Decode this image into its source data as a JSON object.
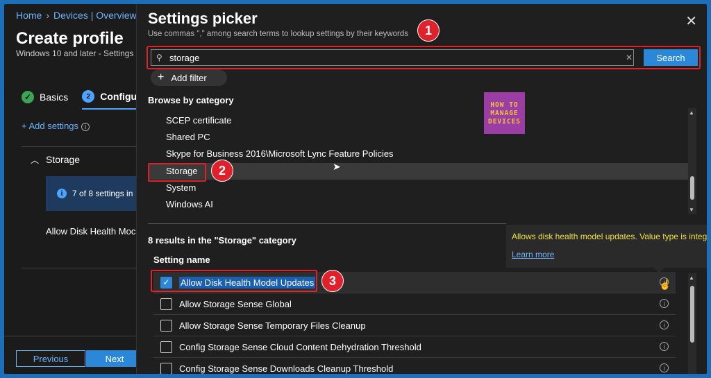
{
  "breadcrumb": {
    "home": "Home",
    "devices": "Devices | Overview"
  },
  "page": {
    "title": "Create profile",
    "subtitle": "Windows 10 and later - Settings"
  },
  "steps": {
    "basics": "Basics",
    "configuration": "Configu",
    "step2_num": "2"
  },
  "add_settings": "+ Add settings",
  "storage_section": "Storage",
  "info_text": "7 of 8 settings in",
  "left_setting": "Allow Disk Health Moc",
  "buttons": {
    "previous": "Previous",
    "next": "Next"
  },
  "picker": {
    "title": "Settings picker",
    "subtitle": "Use commas \",\" among search terms to lookup settings by their keywords",
    "close": "✕",
    "search_value": "storage",
    "search_button": "Search",
    "add_filter": "Add filter",
    "browse_title": "Browse by category",
    "categories": [
      "SCEP certificate",
      "Shared PC",
      "Skype for Business 2016\\Microsoft Lync Feature Policies",
      "Storage",
      "System",
      "Windows AI"
    ],
    "results_title": "8 results in the \"Storage\" category",
    "column_header": "Setting name",
    "results": [
      {
        "label": "Allow Disk Health Model Updates",
        "checked": true
      },
      {
        "label": "Allow Storage Sense Global",
        "checked": false
      },
      {
        "label": "Allow Storage Sense Temporary Files Cleanup",
        "checked": false
      },
      {
        "label": "Config Storage Sense Cloud Content Dehydration Threshold",
        "checked": false
      },
      {
        "label": "Config Storage Sense Downloads Cleanup Threshold",
        "checked": false
      }
    ],
    "tooltip": {
      "text": "Allows disk health model updates. Value type is integer.",
      "link": "Learn more"
    }
  },
  "logo": {
    "line1": "HOW TO",
    "line2": "MANAGE",
    "line3": "DEVICES"
  },
  "badges": [
    "1",
    "2",
    "3"
  ],
  "colors": {
    "accent": "#2b88d8",
    "highlight_red": "#e0202a",
    "tooltip_text": "#f0e040"
  }
}
